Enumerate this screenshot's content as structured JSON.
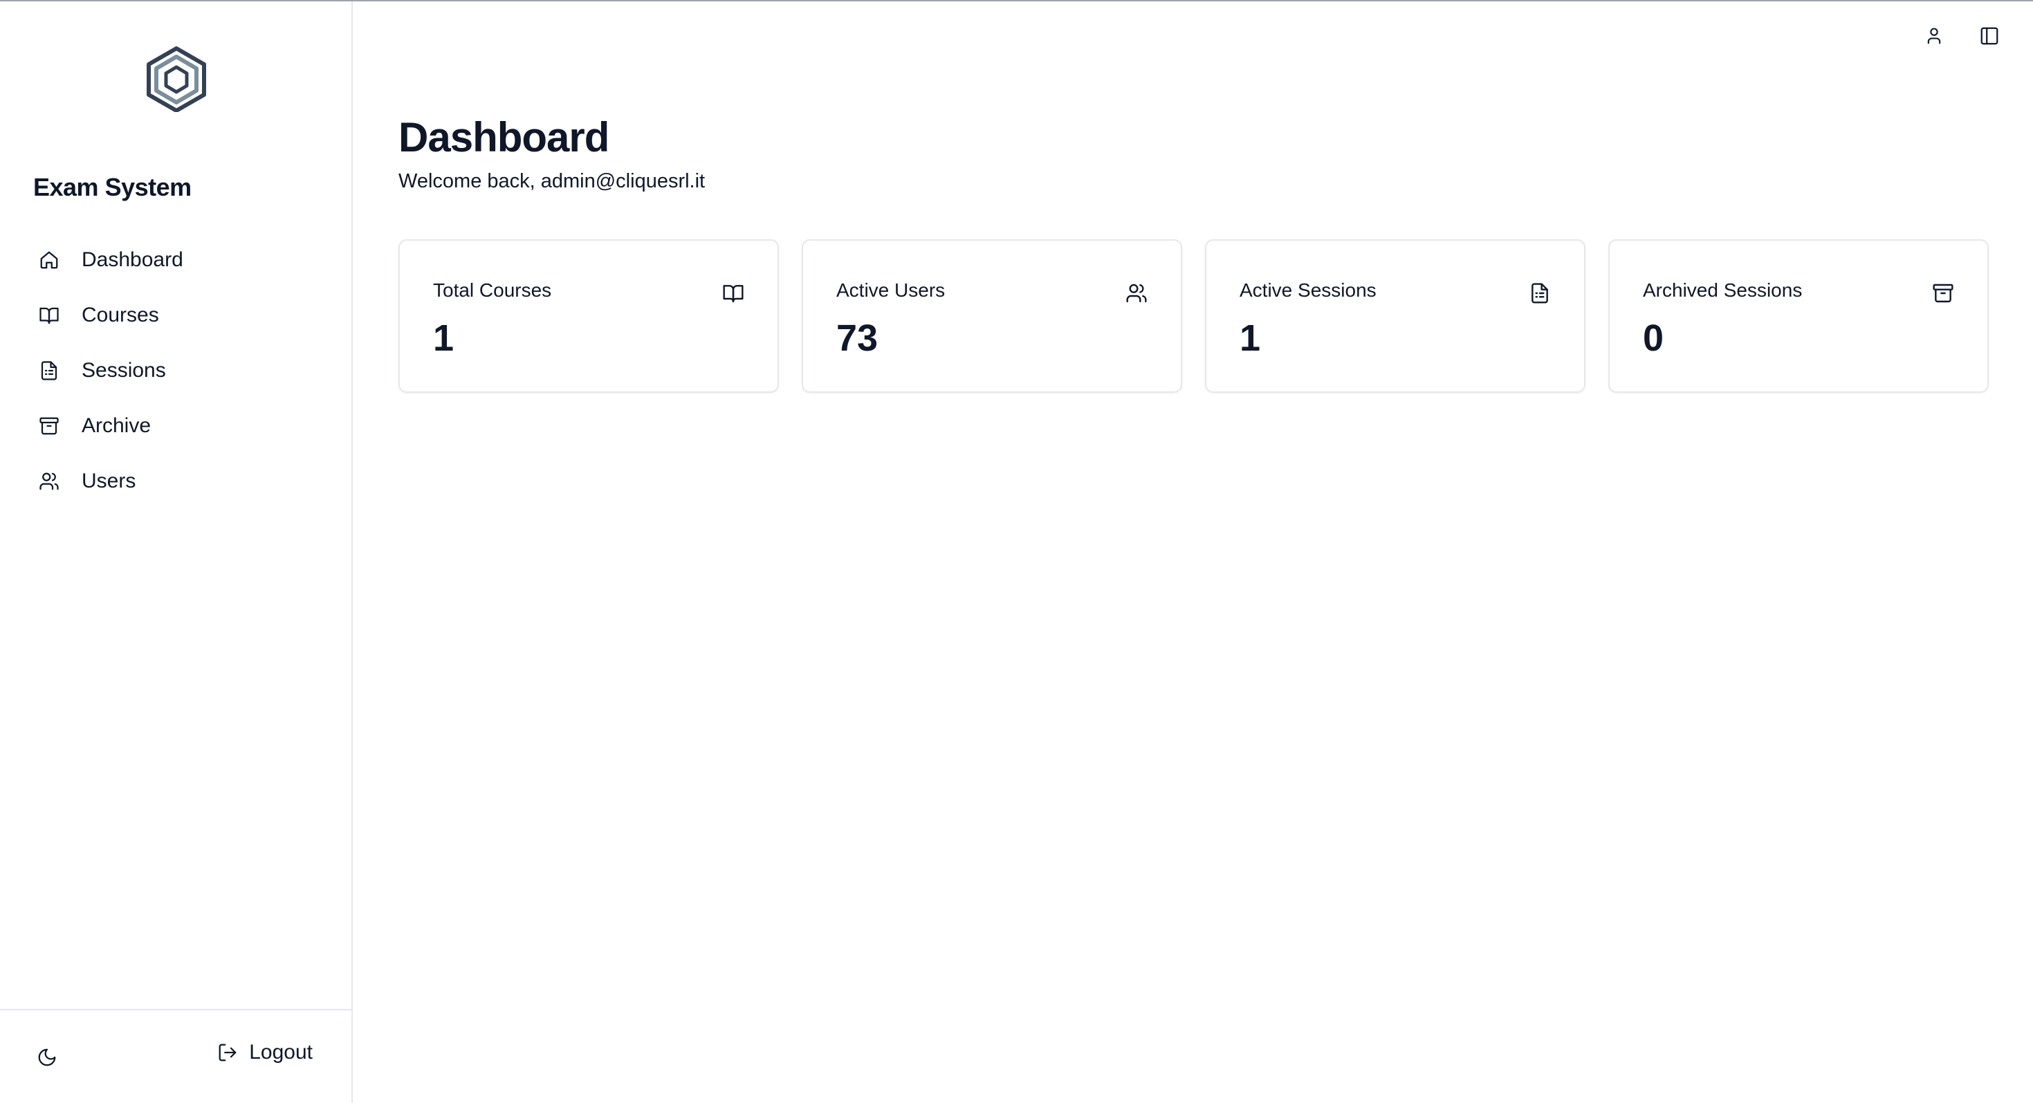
{
  "app": {
    "title": "Exam System",
    "logo_icon": "hexagon-logo-icon"
  },
  "sidebar": {
    "items": [
      {
        "label": "Dashboard",
        "icon": "home-icon"
      },
      {
        "label": "Courses",
        "icon": "book-icon"
      },
      {
        "label": "Sessions",
        "icon": "file-list-icon"
      },
      {
        "label": "Archive",
        "icon": "archive-icon"
      },
      {
        "label": "Users",
        "icon": "users-icon"
      }
    ],
    "footer": {
      "theme_icon": "moon-icon",
      "logout_label": "Logout",
      "logout_icon": "logout-icon"
    }
  },
  "topbar": {
    "icons": [
      "user-icon",
      "sidebar-toggle-icon"
    ]
  },
  "main": {
    "title": "Dashboard",
    "welcome": "Welcome back, admin@cliquesrl.it",
    "stats": [
      {
        "label": "Total Courses",
        "value": "1",
        "icon": "book-icon"
      },
      {
        "label": "Active Users",
        "value": "73",
        "icon": "users-icon"
      },
      {
        "label": "Active Sessions",
        "value": "1",
        "icon": "file-list-icon"
      },
      {
        "label": "Archived Sessions",
        "value": "0",
        "icon": "archive-icon"
      }
    ]
  },
  "colors": {
    "text": "#0f172a",
    "border": "#e5e7eb",
    "logo_dark": "#334155",
    "logo_light": "#7b8e9c"
  }
}
